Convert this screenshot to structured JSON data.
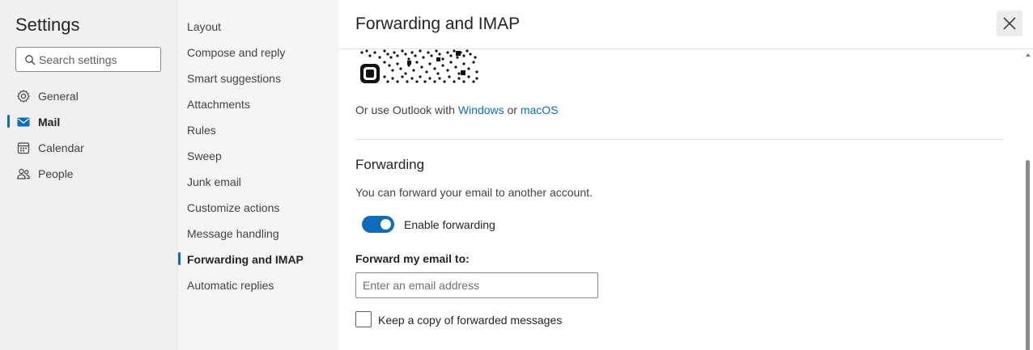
{
  "nav": {
    "title": "Settings",
    "search_placeholder": "Search settings",
    "items": [
      {
        "label": "General",
        "icon": "gear-icon"
      },
      {
        "label": "Mail",
        "icon": "mail-icon",
        "active": true
      },
      {
        "label": "Calendar",
        "icon": "calendar-icon"
      },
      {
        "label": "People",
        "icon": "people-icon"
      }
    ]
  },
  "subnav": {
    "items": [
      {
        "label": "Layout"
      },
      {
        "label": "Compose and reply"
      },
      {
        "label": "Smart suggestions"
      },
      {
        "label": "Attachments"
      },
      {
        "label": "Rules"
      },
      {
        "label": "Sweep"
      },
      {
        "label": "Junk email"
      },
      {
        "label": "Customize actions"
      },
      {
        "label": "Message handling"
      },
      {
        "label": "Forwarding and IMAP",
        "active": true
      },
      {
        "label": "Automatic replies"
      }
    ]
  },
  "panel": {
    "title": "Forwarding and IMAP",
    "outlook": {
      "prefix": "Or use Outlook with ",
      "windows_link": "Windows",
      "connector": " or ",
      "macos_link": "macOS"
    },
    "forwarding": {
      "title": "Forwarding",
      "description": "You can forward your email to another account.",
      "toggle_label": "Enable forwarding",
      "toggle_on": true,
      "field_label": "Forward my email to:",
      "email_placeholder": "Enter an email address",
      "email_value": "",
      "keep_copy_label": "Keep a copy of forwarded messages",
      "keep_copy_checked": false
    }
  },
  "colors": {
    "accent": "#0f6cbd",
    "nav_bg": "#f0f0f0",
    "subnav_bg": "#f5f5f5"
  }
}
